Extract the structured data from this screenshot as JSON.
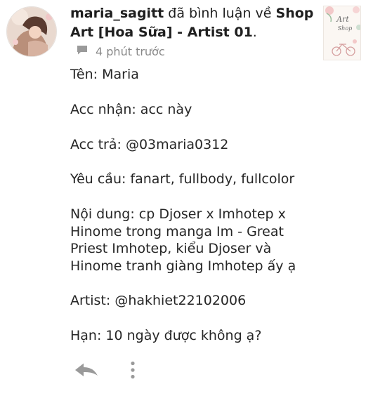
{
  "notification": {
    "username": "maria_sagitt",
    "action_text": "đã bình luận về",
    "target_part1": "Shop",
    "target_part2": "Art [Hoa Sữa] - Artist 01",
    "period": ".",
    "timestamp": "4 phút trước",
    "thumbnail_text_1": "Art",
    "thumbnail_text_2": "Shop"
  },
  "comment": {
    "line_name": "Tên: Maria",
    "line_acc_receive": "Acc nhận: acc này",
    "line_acc_pay": "Acc trả: @03maria0312",
    "line_request": "Yêu cầu: fanart, fullbody, fullcolor",
    "content_1": "Nội dung: cp Djoser x Imhotep x",
    "content_2": "Hinome trong manga Im - Great",
    "content_3": "Priest Imhotep, kiểu Djoser và",
    "content_4": "Hinome tranh giàng Imhotep ấy ạ",
    "line_artist": "Artist: @hakhiet22102006",
    "line_deadline": "Hạn: 10 ngày được không ạ?"
  },
  "icons": {
    "comment": "speech-bubble-icon",
    "reply": "reply-arrow-icon",
    "more": "more-vertical-icon"
  },
  "colors": {
    "text": "#262626",
    "muted": "#888888",
    "icon": "#9a9a9a",
    "background": "#ffffff"
  }
}
